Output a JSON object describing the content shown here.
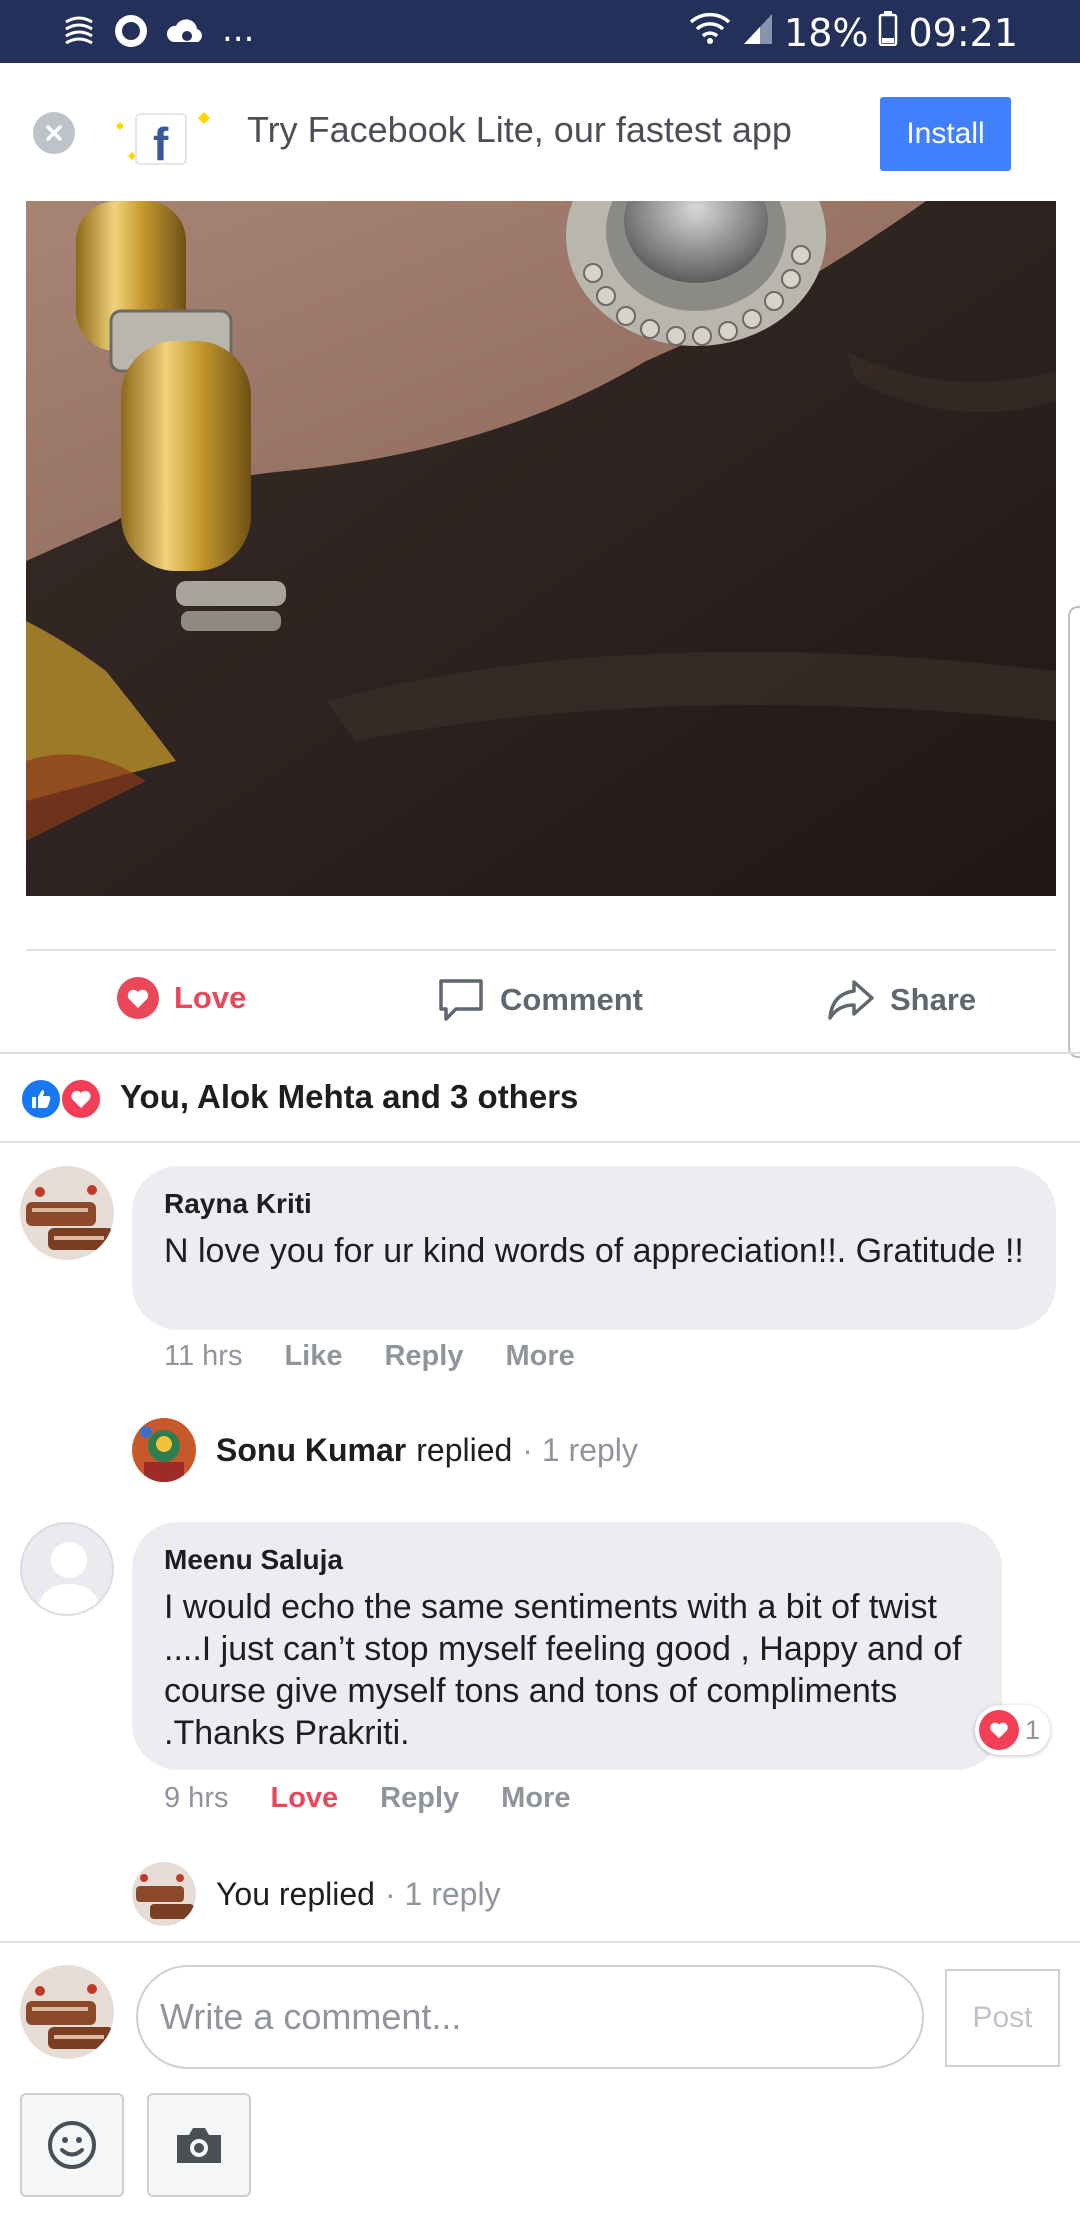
{
  "status_bar": {
    "overflow_indicator": "...",
    "battery": "18%",
    "time": "09:21",
    "icons": [
      "notification-wave-icon",
      "record-icon",
      "cloud-sync-icon",
      "wifi-icon",
      "signal-icon",
      "battery-icon"
    ],
    "background": "#23305a"
  },
  "banner": {
    "text": "Try Facebook Lite, our fastest app",
    "install_label": "Install",
    "accent": "#4080ff"
  },
  "actions": {
    "love_label": "Love",
    "comment_label": "Comment",
    "share_label": "Share",
    "love_color": "#e9475a"
  },
  "reactions": {
    "summary": "You, Alok Mehta and 3 others"
  },
  "comments": [
    {
      "author": "Rayna Kriti",
      "text": "N love you for ur kind words of appreciation!!. Gratitude !!",
      "time": "11 hrs",
      "actions": [
        "Like",
        "Reply",
        "More"
      ],
      "reply_preview": {
        "name": "Sonu Kumar",
        "verb": "replied",
        "count": "· 1 reply"
      }
    },
    {
      "author": "Meenu Saluja",
      "text": "I would echo the same sentiments with a bit of twist ....I just can’t stop myself feeling good , Happy and of course give myself tons and tons of compliments .Thanks Prakriti.",
      "time": "9 hrs",
      "actions": [
        "Love",
        "Reply",
        "More"
      ],
      "reaction_count": "1",
      "reply_preview": {
        "name": "You replied",
        "count": "· 1 reply"
      }
    }
  ],
  "composer": {
    "placeholder": "Write a comment...",
    "post_label": "Post"
  }
}
